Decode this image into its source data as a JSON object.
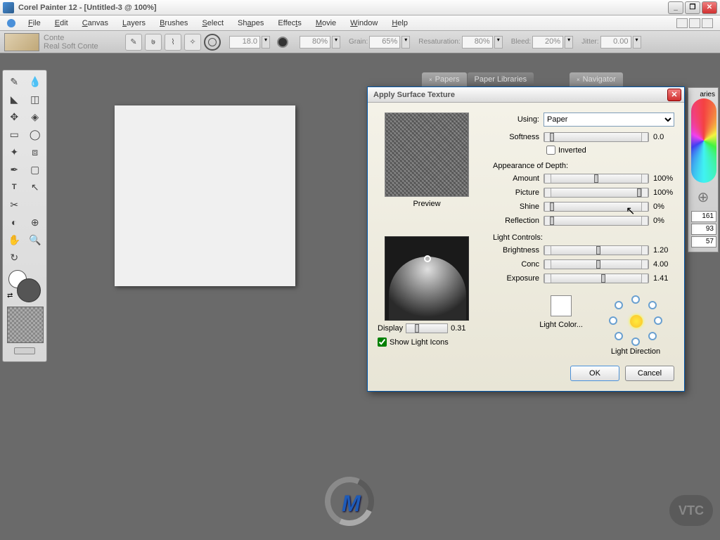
{
  "titlebar": "Corel Painter 12 - [Untitled-3 @ 100%]",
  "menu": [
    "File",
    "Edit",
    "Canvas",
    "Layers",
    "Brushes",
    "Select",
    "Shapes",
    "Effects",
    "Movie",
    "Window",
    "Help"
  ],
  "brush": {
    "category": "Conte",
    "variant": "Real Soft Conte"
  },
  "props": {
    "size": "18.0",
    "opacity": "80%",
    "grain_label": "Grain:",
    "grain": "65%",
    "resat_label": "Resaturation:",
    "resat": "80%",
    "bleed_label": "Bleed:",
    "bleed": "20%",
    "jitter_label": "Jitter:",
    "jitter": "0.00"
  },
  "panels": {
    "papers": "Papers",
    "paperlib": "Paper Libraries",
    "navigator": "Navigator",
    "aries": "aries"
  },
  "sidenum": [
    "161",
    "93",
    "57"
  ],
  "dialog": {
    "title": "Apply Surface Texture",
    "preview": "Preview",
    "using_label": "Using:",
    "using_value": "Paper",
    "softness_label": "Softness",
    "softness_val": "0.0",
    "inverted": "Inverted",
    "depth_h": "Appearance of Depth:",
    "amount_l": "Amount",
    "amount_v": "100%",
    "picture_l": "Picture",
    "picture_v": "100%",
    "shine_l": "Shine",
    "shine_v": "0%",
    "reflect_l": "Reflection",
    "reflect_v": "0%",
    "light_h": "Light Controls:",
    "bright_l": "Brightness",
    "bright_v": "1.20",
    "conc_l": "Conc",
    "conc_v": "4.00",
    "exp_l": "Exposure",
    "exp_v": "1.41",
    "display_l": "Display",
    "display_v": "0.31",
    "showlight": "Show Light Icons",
    "lightcolor": "Light Color...",
    "lightdir": "Light Direction",
    "ok": "OK",
    "cancel": "Cancel"
  },
  "vtc": "VTC"
}
